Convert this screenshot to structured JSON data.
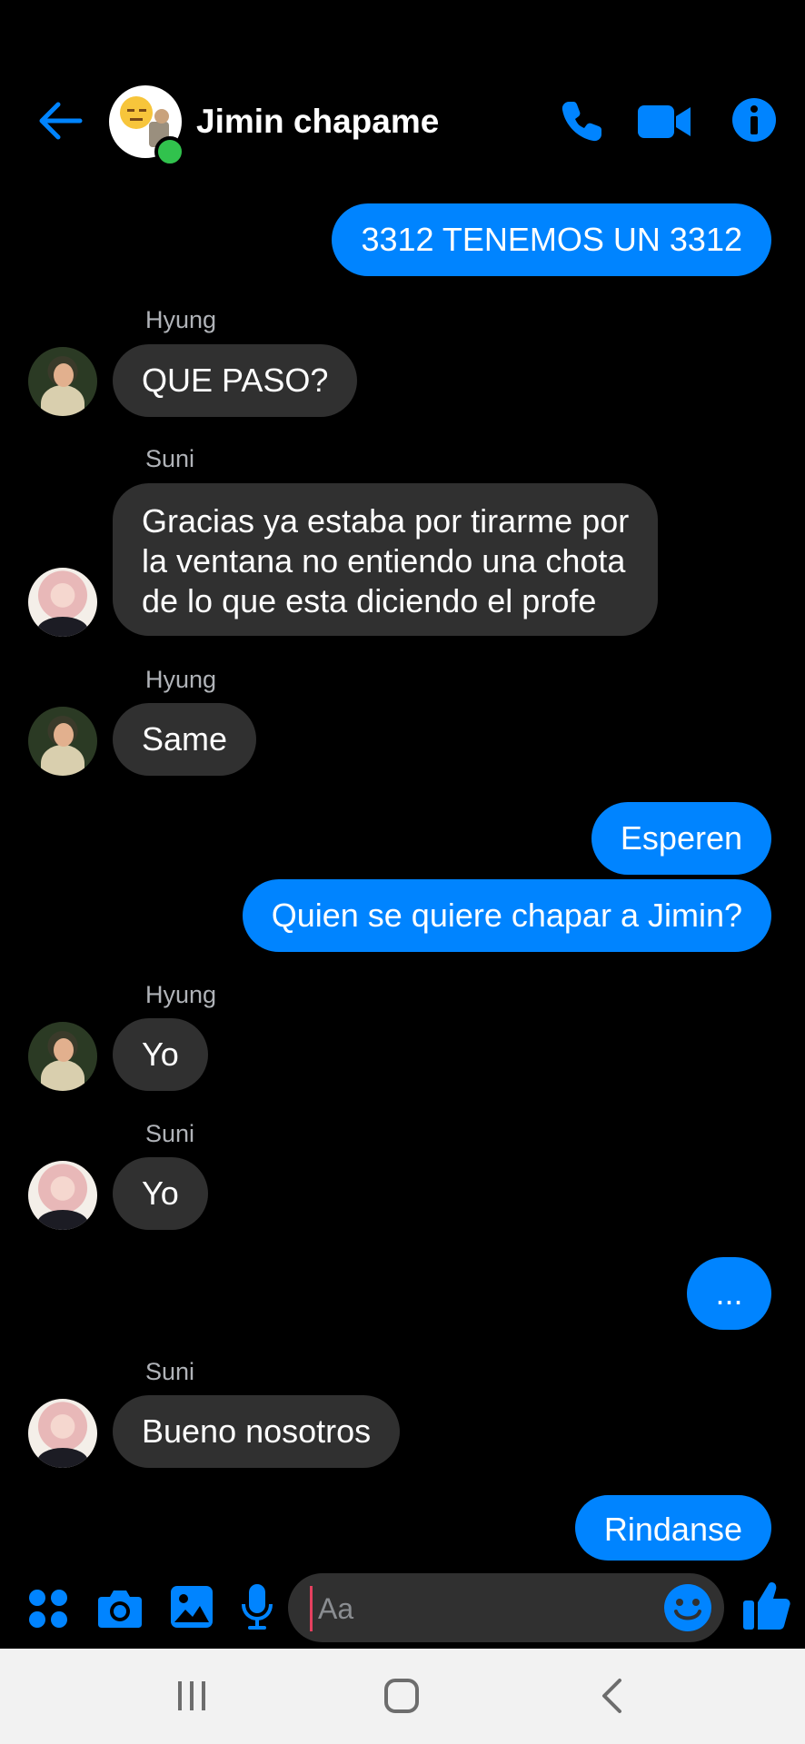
{
  "header": {
    "title": "Jimin chapame",
    "back_icon": "arrow-left-icon",
    "call_icon": "phone-icon",
    "video_icon": "video-camera-icon",
    "info_icon": "info-icon",
    "accent": "#0084ff",
    "online_color": "#31c24d"
  },
  "messages": [
    {
      "kind": "out",
      "text": "3312 TENEMOS UN 3312"
    },
    {
      "kind": "in",
      "sender": "Hyung",
      "text": "QUE PASO?"
    },
    {
      "kind": "in",
      "sender": "Suni",
      "lines": [
        "Gracias ya estaba por tirarme por",
        "la ventana no entiendo una chota",
        "de lo que esta diciendo el profe"
      ]
    },
    {
      "kind": "in",
      "sender": "Hyung",
      "text": "Same"
    },
    {
      "kind": "out",
      "text": "Esperen"
    },
    {
      "kind": "out",
      "text": "Quien se quiere chapar a Jimin?"
    },
    {
      "kind": "in",
      "sender": "Hyung",
      "text": "Yo"
    },
    {
      "kind": "in",
      "sender": "Suni",
      "text": "Yo"
    },
    {
      "kind": "out",
      "text": "..."
    },
    {
      "kind": "in",
      "sender": "Suni",
      "text": "Bueno nosotros"
    },
    {
      "kind": "out",
      "text": "Rindanse"
    }
  ],
  "composer": {
    "placeholder": "Aa",
    "icons": [
      "apps-icon",
      "camera-icon",
      "gallery-icon",
      "microphone-icon",
      "emoji-icon",
      "thumbs-up-icon"
    ]
  },
  "system_nav": {
    "icons": [
      "recent-apps-icon",
      "home-icon",
      "back-icon"
    ],
    "background": "#f2f2f2"
  }
}
